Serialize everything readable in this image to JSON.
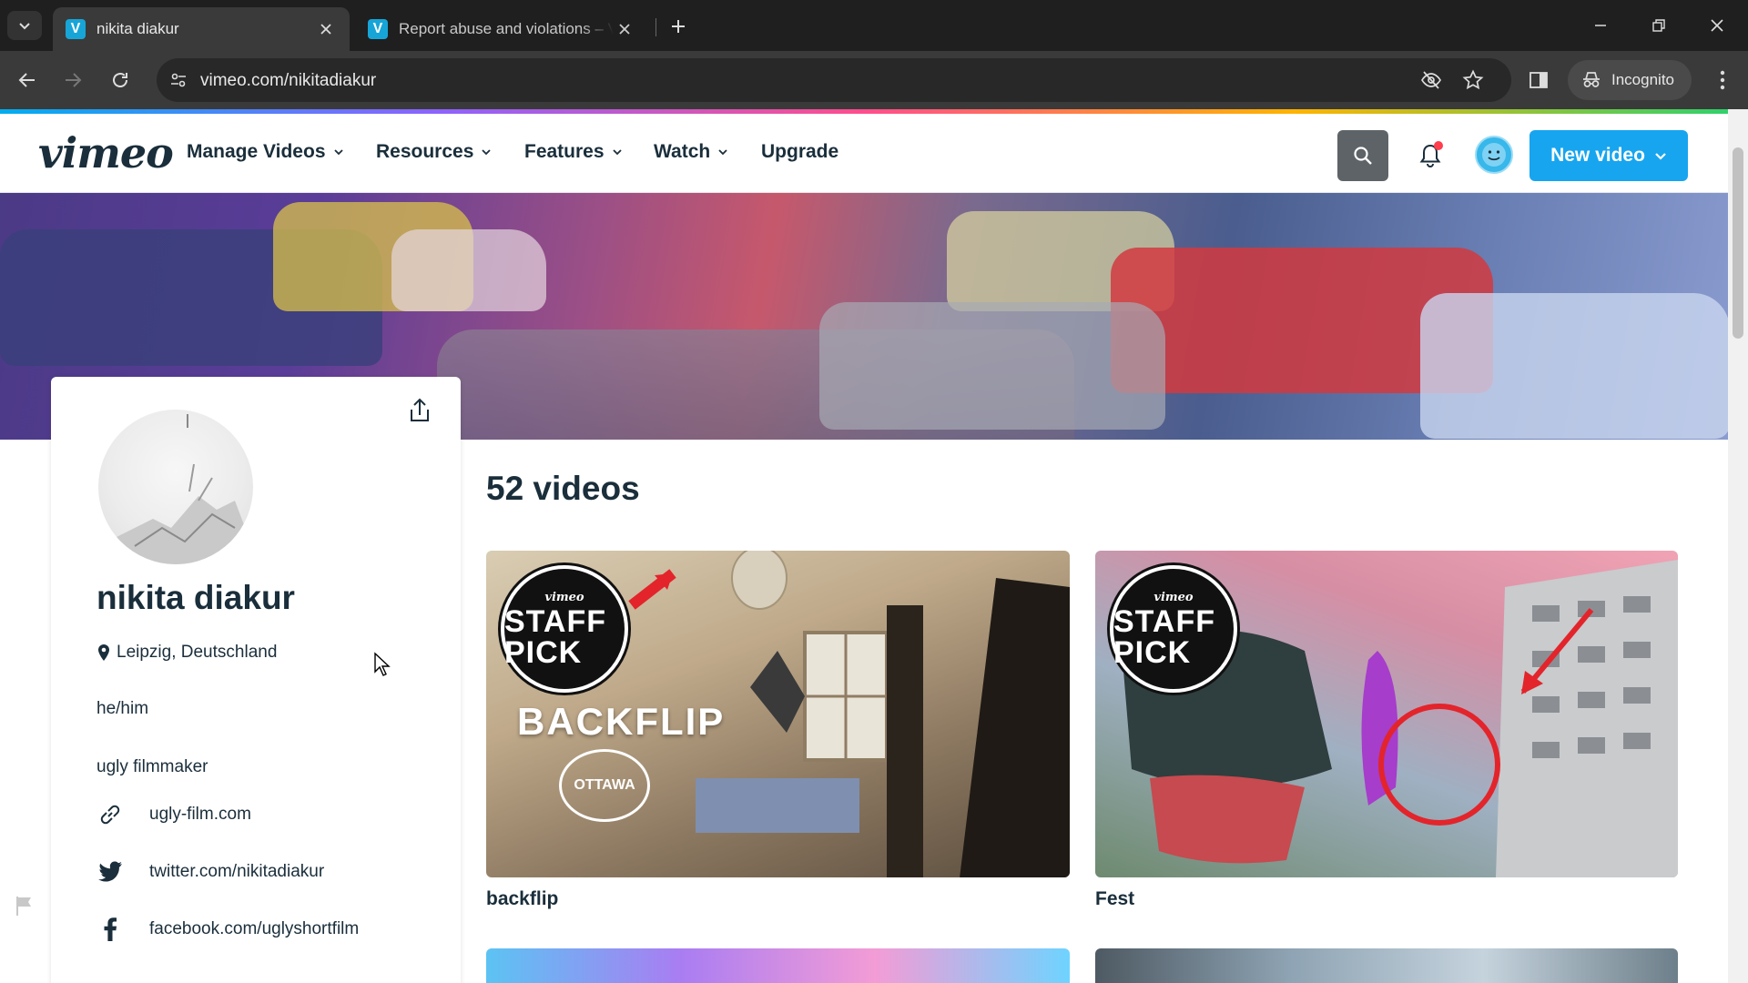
{
  "browser": {
    "tabs": [
      {
        "title": "nikita diakur",
        "favicon": "V"
      },
      {
        "title": "Report abuse and violations – V",
        "favicon": "V"
      }
    ],
    "url": "vimeo.com/nikitadiakur",
    "incognito_label": "Incognito"
  },
  "vimeo_nav": {
    "logo": "vimeo",
    "menu": [
      "Manage Videos",
      "Resources",
      "Features",
      "Watch",
      "Upgrade"
    ],
    "new_video_label": "New video"
  },
  "profile": {
    "name": "nikita diakur",
    "location": "Leipzig, Deutschland",
    "pronouns": "he/him",
    "bio": "ugly filmmaker",
    "links": [
      {
        "icon": "link-icon",
        "text": "ugly-film.com"
      },
      {
        "icon": "twitter-icon",
        "text": "twitter.com/nikitadiakur"
      },
      {
        "icon": "facebook-icon",
        "text": "facebook.com/uglyshortfilm"
      }
    ]
  },
  "videos": {
    "count_label": "52 videos",
    "items": [
      {
        "title": "backflip",
        "badge_top": "vimeo",
        "badge_text": "STAFF PICK",
        "overlay_word": "BACKFLIP",
        "laurel": "OTTAWA"
      },
      {
        "title": "Fest",
        "badge_top": "vimeo",
        "badge_text": "STAFF PICK"
      }
    ]
  },
  "colors": {
    "accent": "#17a5ef",
    "text_dark": "#1a2e3b",
    "notification_dot": "#ff3d4d"
  }
}
